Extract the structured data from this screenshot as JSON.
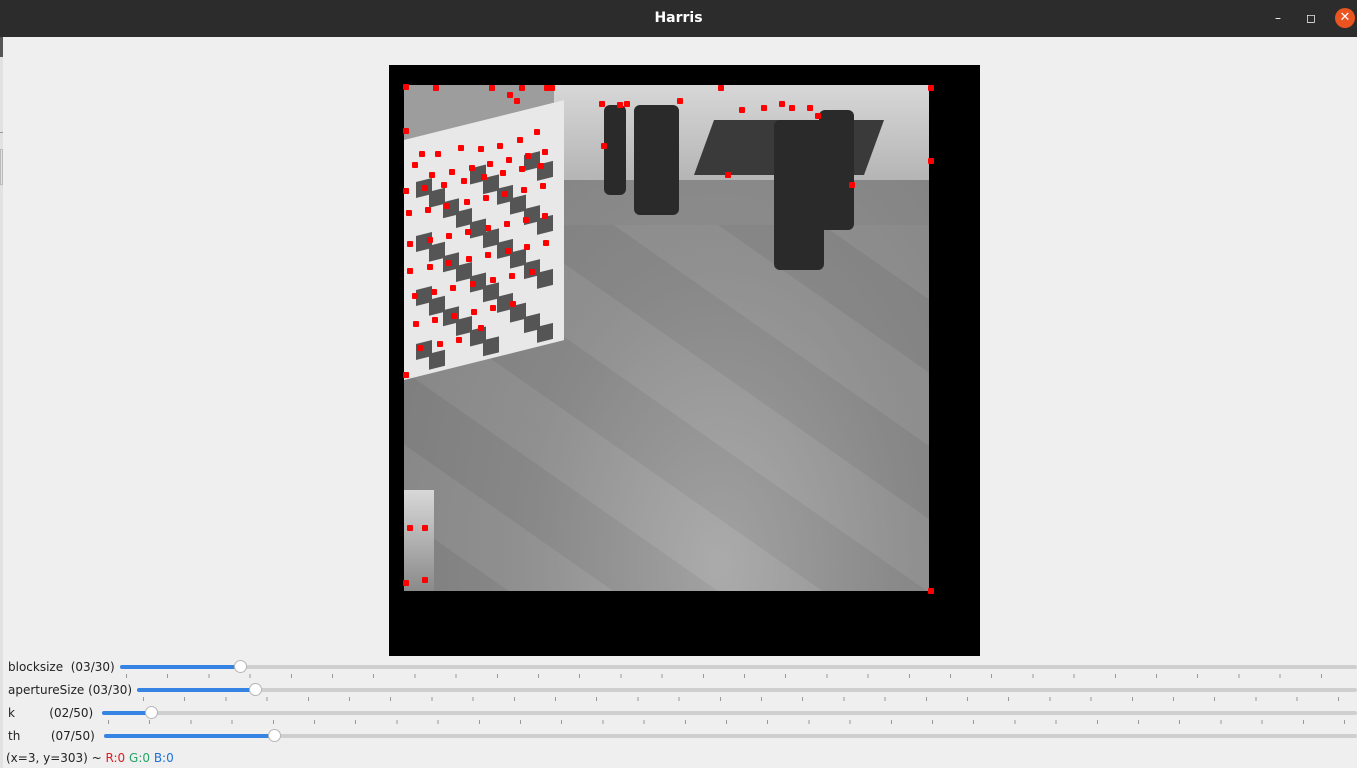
{
  "window": {
    "title": "Harris",
    "minimize_icon": "minimize-icon",
    "maximize_icon": "maximize-icon",
    "close_icon": "close-icon",
    "minimize_glyph": "–",
    "maximize_glyph": "◻",
    "close_glyph": "✕",
    "close_color": "#e95420"
  },
  "trackbars": [
    {
      "label": "blocksize  (03/30)",
      "value": 3,
      "max": 30
    },
    {
      "label": "apertureSize (03/30)",
      "value": 3,
      "max": 30
    },
    {
      "label": "k         (02/50)",
      "value": 2,
      "max": 50
    },
    {
      "label": "th        (07/50)",
      "value": 7,
      "max": 50
    }
  ],
  "status": {
    "coords": "(x=3, y=303) ~ ",
    "r": "R:0",
    "g": "G:0",
    "b": "B:0"
  },
  "image": {
    "corner_color": "#ff0000",
    "accent_color": "#3584e4"
  }
}
